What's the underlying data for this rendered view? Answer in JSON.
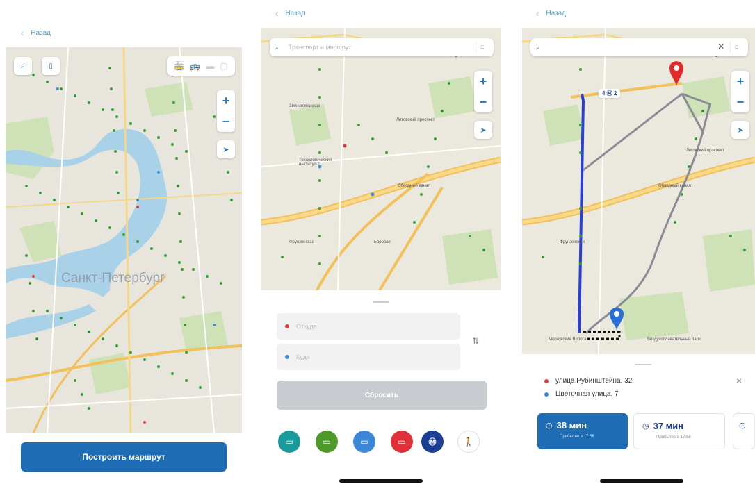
{
  "screen1": {
    "back_label": "Назад",
    "city_label": "Санкт-Петербург",
    "build_route_label": "Построить маршрут"
  },
  "screen2": {
    "back_label": "Назад",
    "search_placeholder": "Транспорт и маршрут",
    "from_placeholder": "Откуда",
    "to_placeholder": "Куда",
    "reset_label": "Сбросить",
    "transport_modes": [
      {
        "name": "tram",
        "color": "#1a9a9a",
        "glyph": "🚋"
      },
      {
        "name": "bus",
        "color": "#4d9a2a",
        "glyph": "🚌"
      },
      {
        "name": "trolleybus",
        "color": "#3b87d6",
        "glyph": "🚎"
      },
      {
        "name": "commercial-bus",
        "color": "#e0303a",
        "glyph": "🚐"
      },
      {
        "name": "metro",
        "color": "#1c3f94",
        "glyph": "Ⓜ"
      },
      {
        "name": "walk",
        "color": "#ffffff",
        "glyph": "🚶"
      }
    ],
    "map_labels": [
      "Литовский проспект",
      "Обводный канал",
      "Технологический институт-2",
      "Фрунзенская",
      "Боровая",
      "Звенигородская"
    ]
  },
  "screen3": {
    "back_label": "Назад",
    "from_address": "улица Рубинштейна, 32",
    "to_address": "Цветочная улица, 7",
    "route_badge": "4 Ⓜ 2",
    "map_labels": [
      "Лиговский проспект",
      "Обводный канал",
      "Фрунзенская",
      "Московские Ворота",
      "Воздухоплавательный парк"
    ],
    "cards": [
      {
        "time": "38 мин",
        "arrival": "Прибытие в 17:58"
      },
      {
        "time": "37 мин",
        "arrival": "Прибытие в 17:58"
      }
    ]
  },
  "colors": {
    "accent": "#1e6cb4",
    "link": "#4a9fd8",
    "metro_line": "#2a3fd8",
    "route_gray": "#8b8b95",
    "pin_red": "#e32b2b",
    "pin_blue": "#2a6fd6"
  }
}
